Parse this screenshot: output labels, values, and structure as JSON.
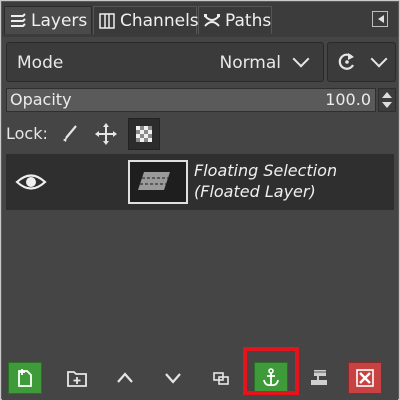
{
  "tabs": [
    {
      "label": "Layers",
      "icon": "layers-icon"
    },
    {
      "label": "Channels",
      "icon": "channels-icon"
    },
    {
      "label": "Paths",
      "icon": "paths-icon"
    }
  ],
  "mode": {
    "label": "Mode",
    "value": "Normal"
  },
  "opacity": {
    "label": "Opacity",
    "value": "100.0"
  },
  "lock": {
    "label": "Lock:"
  },
  "layers": [
    {
      "name_line1": "Floating Selection",
      "name_line2": "(Floated Layer)",
      "visible": true
    }
  ],
  "toolbar": {
    "buttons": [
      "new-layer",
      "new-layer-group",
      "raise-layer",
      "lower-layer",
      "duplicate-layer",
      "anchor-layer",
      "merge-down",
      "delete-layer"
    ],
    "highlighted": "anchor-layer"
  },
  "colors": {
    "panel_bg": "#454545",
    "accent_green": "#3f9b3a",
    "accent_red": "#c74343",
    "highlight_border": "#e3141c"
  }
}
